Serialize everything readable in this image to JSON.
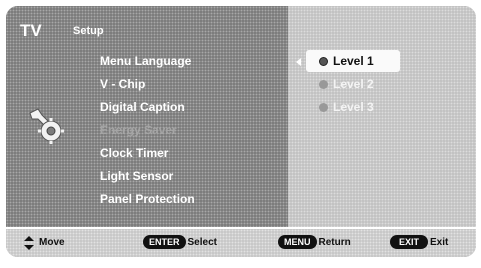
{
  "header": {
    "tv_label": "TV",
    "section_title": "Setup"
  },
  "menu": {
    "items": [
      {
        "label": "Menu Language",
        "enabled": true
      },
      {
        "label": "V - Chip",
        "enabled": true
      },
      {
        "label": "Digital Caption",
        "enabled": true
      },
      {
        "label": "Energy Saver",
        "enabled": false
      },
      {
        "label": "Clock Timer",
        "enabled": true
      },
      {
        "label": "Light Sensor",
        "enabled": true
      },
      {
        "label": "Panel Protection",
        "enabled": true
      }
    ],
    "active_item": "Energy Saver"
  },
  "options": {
    "items": [
      {
        "label": "Level 1",
        "selected": true
      },
      {
        "label": "Level 2",
        "selected": false
      },
      {
        "label": "Level 3",
        "selected": false
      }
    ]
  },
  "footer": {
    "move_label": "Move",
    "enter_key": "ENTER",
    "enter_label": "Select",
    "menu_key": "MENU",
    "menu_label": "Return",
    "exit_key": "EXIT",
    "exit_label": "Exit"
  },
  "icons": {
    "settings": "gear-wrench-icon",
    "submenu_pointer": "arrow-left-icon",
    "navigation": "up-down-arrow-icon"
  }
}
